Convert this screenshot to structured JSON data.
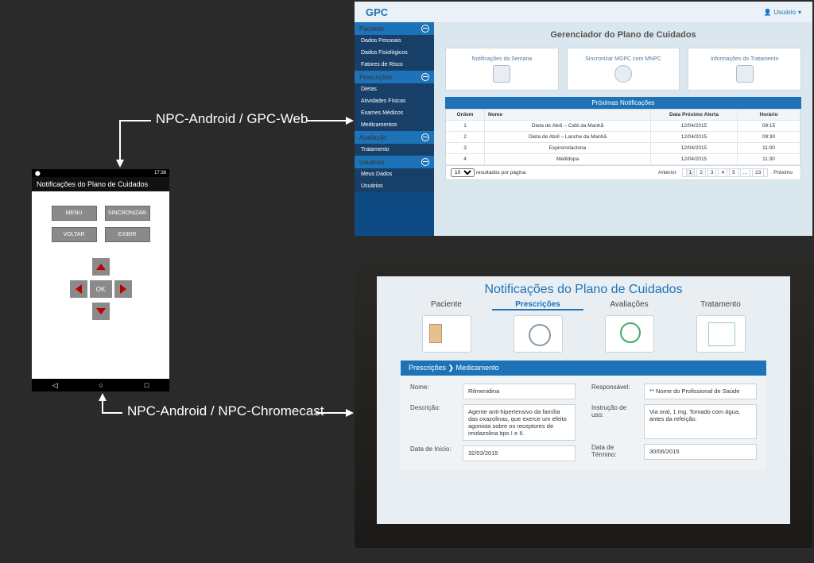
{
  "labels": {
    "top": "NPC-Android / GPC-Web",
    "bottom": "NPC-Android / NPC-Chromecast"
  },
  "phone": {
    "status_left": "⬤",
    "status_right": "17:38",
    "title": "Notificações do Plano de Cuidados",
    "btn_menu": "MENU",
    "btn_sync": "SINCRONIZAR",
    "btn_back": "VOLTAR",
    "btn_show": "EXIBIR",
    "btn_ok": "OK",
    "nav_back": "◁",
    "nav_home": "○",
    "nav_recent": "□"
  },
  "web": {
    "logo": "GPC",
    "user": "Usuário",
    "side": {
      "paciente": "Paciente",
      "dados_pessoais": "Dados Pessoais",
      "dados_fisio": "Dados Fisiológicos",
      "fatores": "Fatores de Risco",
      "prescricoes": "Prescrições",
      "dietas": "Dietas",
      "atividades": "Atividades Físicas",
      "exames": "Exames Médicos",
      "medicamentos": "Medicamentos",
      "avaliacao": "Avaliação",
      "tratamento": "Tratamento",
      "usuarios": "Usuários",
      "meus_dados": "Meus Dados",
      "usuarios2": "Usuários"
    },
    "heading": "Gerenciador do Plano de Cuidados",
    "cards": {
      "c1": "Notificações da Semana",
      "c2": "Sincronizar MGPC com MNPC",
      "c3": "Informações do Tratamento"
    },
    "notif_title": "Próximas Notificações",
    "thead": {
      "c1": "Ordem",
      "c2": "Nome",
      "c3": "Data Próximo Alerta",
      "c4": "Horário"
    },
    "rows": [
      {
        "o": "1",
        "n": "Dieta de Abril – Café da Manhã",
        "d": "12/04/2015",
        "h": "08:15"
      },
      {
        "o": "2",
        "n": "Dieta de Abril – Lanche da Manhã",
        "d": "12/04/2015",
        "h": "09:30"
      },
      {
        "o": "3",
        "n": "Espironolactona",
        "d": "12/04/2015",
        "h": "11:00"
      },
      {
        "o": "4",
        "n": "Metildopa",
        "d": "12/04/2015",
        "h": "11:30"
      }
    ],
    "pager": {
      "left_n": "10",
      "left_t": "resultados por página",
      "prev": "Anterior",
      "next": "Próximo",
      "pages": [
        "1",
        "2",
        "3",
        "4",
        "5",
        "...",
        "23"
      ]
    }
  },
  "tv": {
    "title": "Notificações do Plano de Cuidados",
    "tabs": {
      "paciente": "Paciente",
      "presc": "Prescrições",
      "aval": "Avaliações",
      "trat": "Tratamento"
    },
    "breadcrumb": "Prescrições ❯ Medicamento",
    "left": {
      "nome_l": "Nome:",
      "nome_v": "Rilmenidina",
      "desc_l": "Descrição:",
      "desc_v": "Agente anti-hipertensivo da família das oxazolinas, que exerce um efeito agonista sobre os receptores de imidazolina tipo I e II.",
      "di_l": "Data de Início:",
      "di_v": "32/03/2015"
    },
    "right": {
      "resp_l": "Responsável:",
      "resp_v": "** Nome do Profissional de Saúde",
      "inst_l": "Instrução de uso:",
      "inst_v": "Via oral, 1 mg. Tomado com água, antes da refeição.",
      "dt_l": "Data de Término:",
      "dt_v": "30/06/2015"
    }
  }
}
